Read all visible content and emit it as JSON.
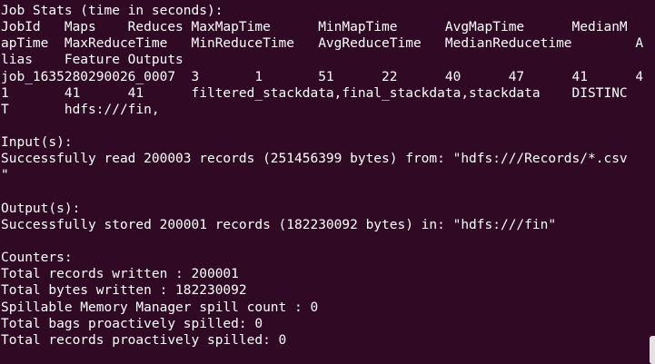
{
  "terminal": {
    "lines": [
      "Job Stats (time in seconds):",
      "JobId   Maps    Reduces MaxMapTime      MinMapTime      AvgMapTime      MedianM",
      "apTime  MaxReduceTime   MinReduceTime   AvgReduceTime   MedianReducetime        A",
      "lias    Feature Outputs",
      "job_1635280290026_0007  3       1       51      22      40      47      41      4",
      "1       41      41      filtered_stackdata,final_stackdata,stackdata    DISTINC",
      "T       hdfs:///fin,",
      "",
      "Input(s):",
      "Successfully read 200003 records (251456399 bytes) from: \"hdfs:///Records/*.csv",
      "\"",
      "",
      "Output(s):",
      "Successfully stored 200001 records (182230092 bytes) in: \"hdfs:///fin\"",
      "",
      "Counters:",
      "Total records written : 200001",
      "Total bytes written : 182230092",
      "Spillable Memory Manager spill count : 0",
      "Total bags proactively spilled: 0",
      "Total records proactively spilled: 0"
    ]
  },
  "colors": {
    "background": "#300a24",
    "foreground": "#ffffff",
    "scrollbar": "#e6e0e3"
  }
}
